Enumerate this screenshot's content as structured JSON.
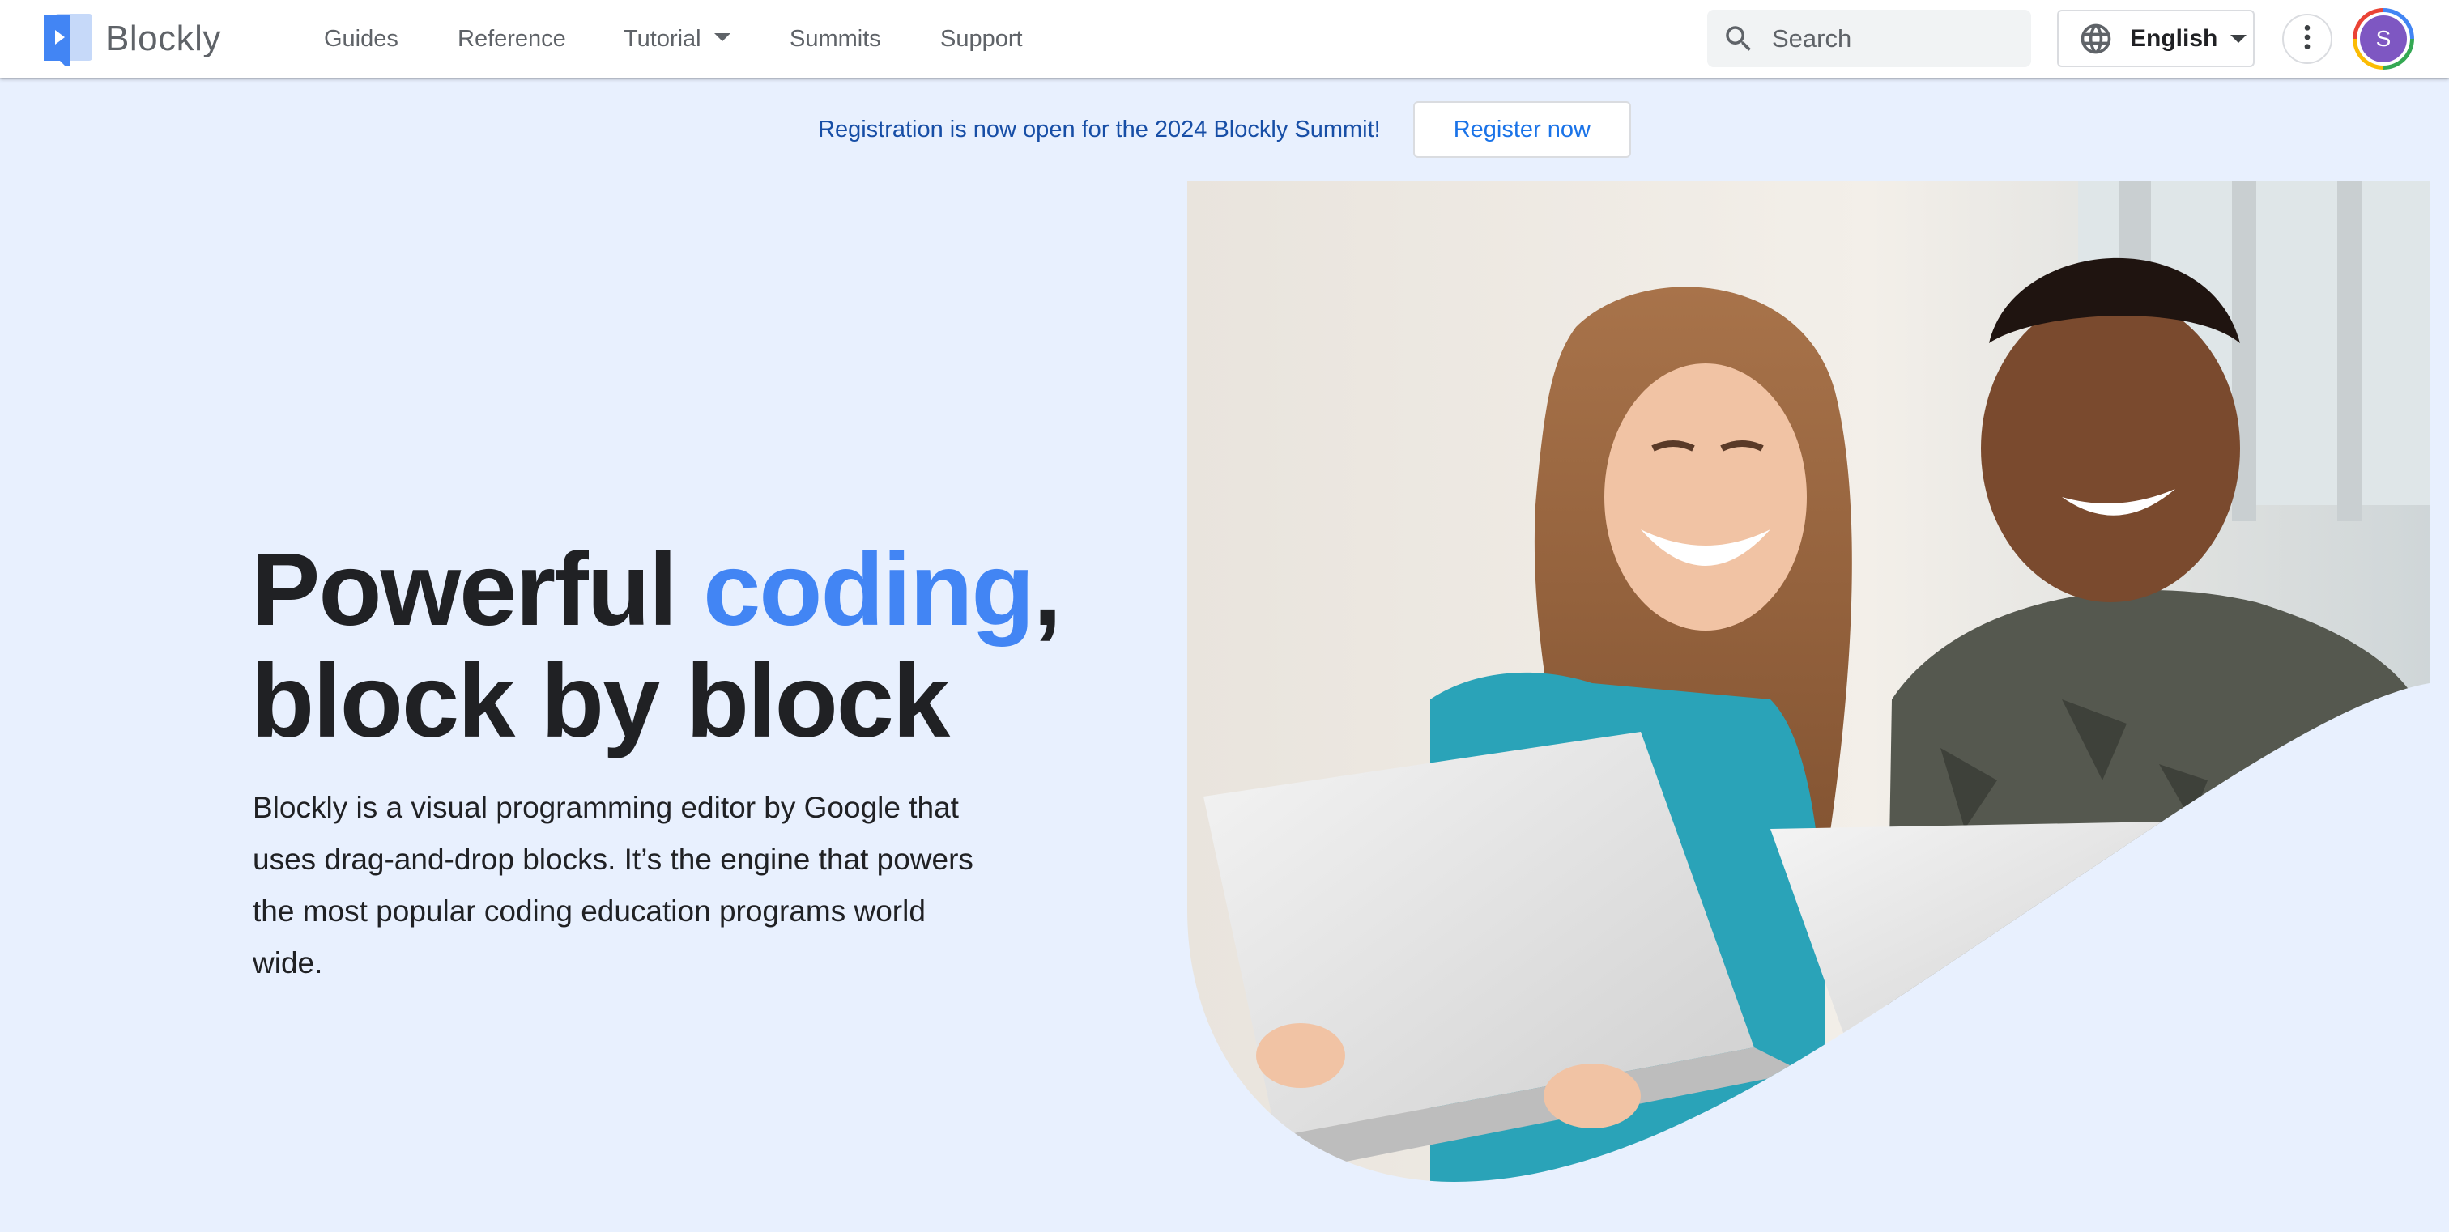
{
  "nav": {
    "brand": "Blockly",
    "links": {
      "guides": "Guides",
      "reference": "Reference",
      "tutorial": "Tutorial",
      "summits": "Summits",
      "support": "Support"
    },
    "search_placeholder": "Search",
    "language": "English",
    "avatar_initial": "S"
  },
  "announcement": {
    "text": "Registration is now open for the 2024 Blockly Summit!",
    "button": "Register now"
  },
  "hero": {
    "title_part1": "Powerful ",
    "title_accent": "coding",
    "title_part2": ",",
    "title_line2": "block by block",
    "description": "Blockly is a visual programming editor by Google that uses drag-and-drop blocks. It’s the engine that powers the most popular coding education programs world wide."
  },
  "colors": {
    "page_bg": "#e8f0fe",
    "accent": "#4285f4",
    "link": "#1a73e8",
    "announcement_text": "#174ea6",
    "avatar_bg": "#7e57c2"
  },
  "icons": {
    "logo": "blockly-logo-icon",
    "search": "search-icon",
    "language": "globe-icon",
    "menu": "more-vert-icon",
    "tutorial_dropdown": "caret-down-icon"
  }
}
